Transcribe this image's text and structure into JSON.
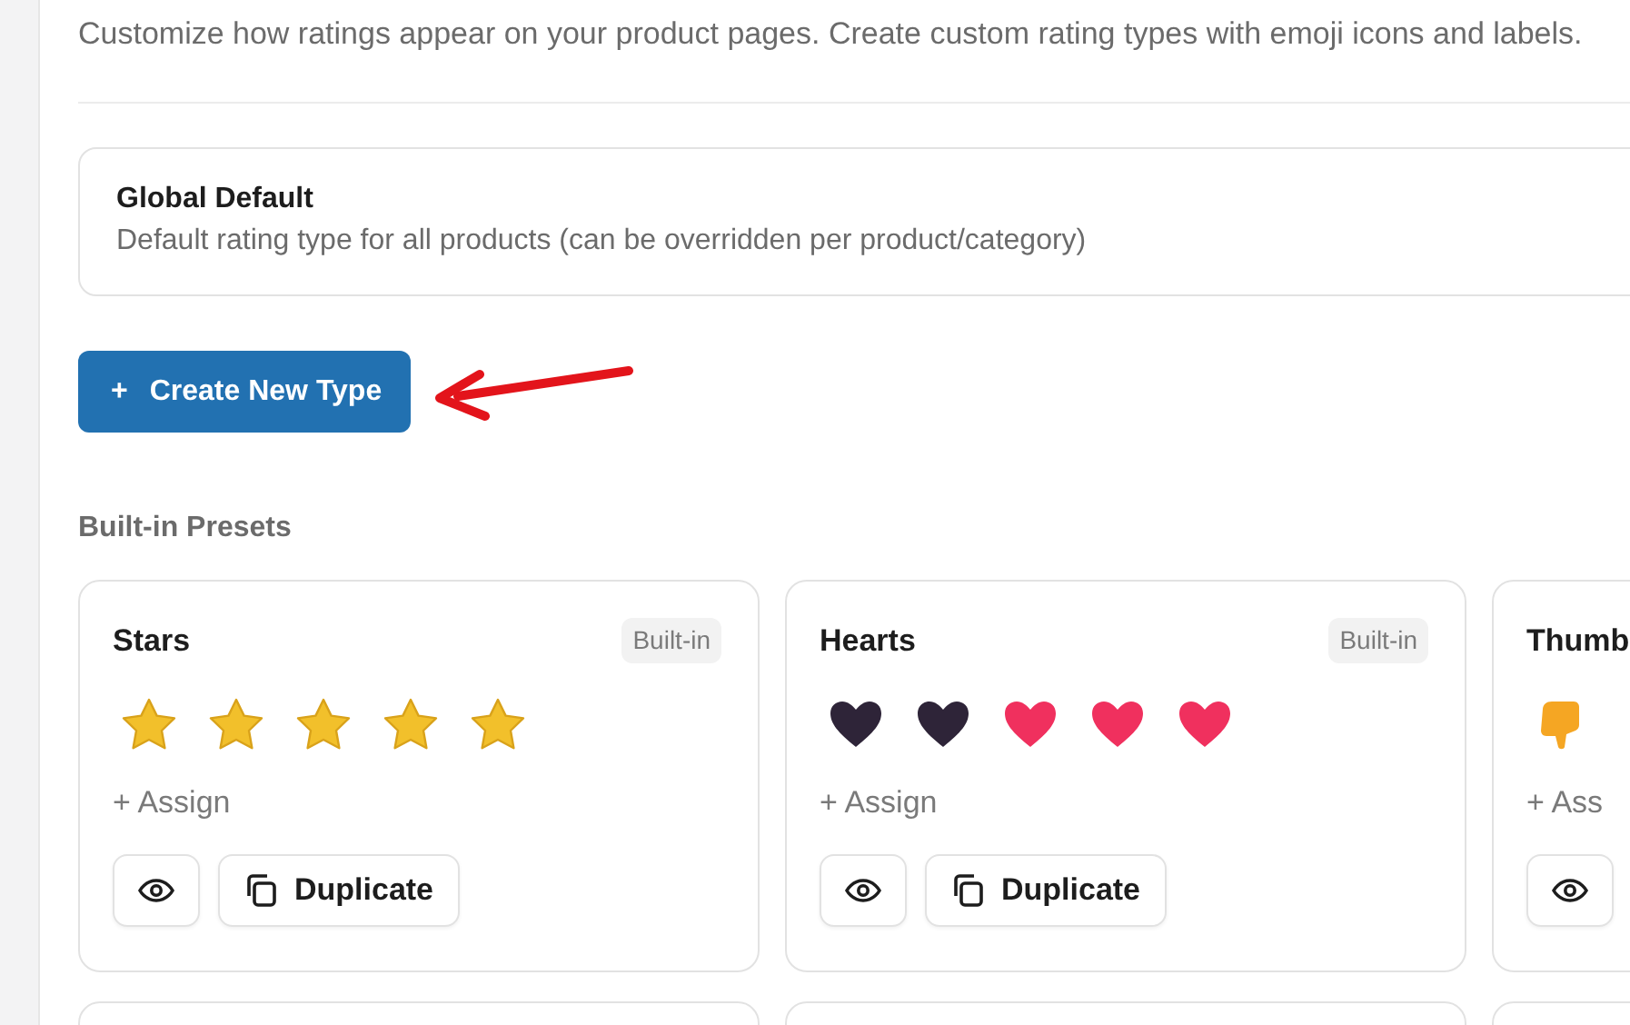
{
  "description": "Customize how ratings appear on your product pages. Create custom rating types with emoji icons and labels.",
  "global_default": {
    "title": "Global Default",
    "subtitle": "Default rating type for all products (can be overridden per product/category)"
  },
  "create_button": {
    "icon": "+",
    "label": "Create New Type"
  },
  "section_title": "Built-in Presets",
  "presets": [
    {
      "title": "Stars",
      "badge": "Built-in",
      "icons": [
        {
          "kind": "star"
        },
        {
          "kind": "star"
        },
        {
          "kind": "star"
        },
        {
          "kind": "star"
        },
        {
          "kind": "star"
        }
      ],
      "assign": "+ Assign",
      "duplicate": "Duplicate"
    },
    {
      "title": "Hearts",
      "badge": "Built-in",
      "icons": [
        {
          "kind": "heart-dark"
        },
        {
          "kind": "heart-dark"
        },
        {
          "kind": "heart"
        },
        {
          "kind": "heart"
        },
        {
          "kind": "heart"
        }
      ],
      "assign": "+ Assign",
      "duplicate": "Duplicate"
    },
    {
      "title": "Thumb",
      "icons": [
        {
          "kind": "thumbs-down"
        }
      ],
      "assign": "+ Ass"
    }
  ]
}
